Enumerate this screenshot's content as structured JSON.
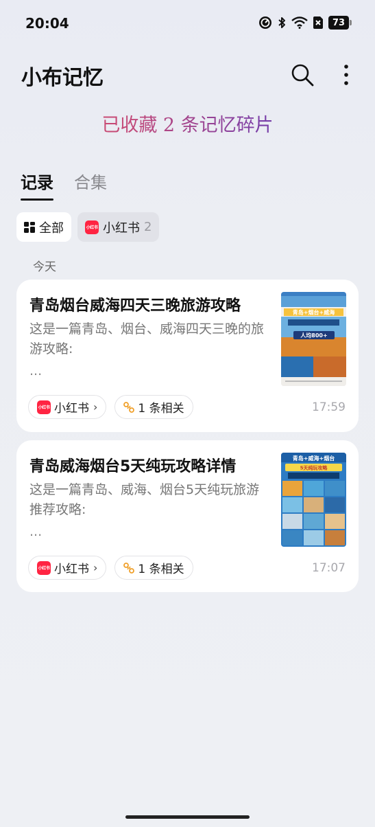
{
  "status_bar": {
    "time": "20:04",
    "battery": "73",
    "icons": [
      "speedometer-icon",
      "bluetooth-icon",
      "wifi-icon",
      "sim-blocked-icon",
      "battery-icon"
    ]
  },
  "app": {
    "title": "小布记忆",
    "search_icon": "search-icon",
    "more_icon": "more-vertical-icon"
  },
  "tagline": "已收藏 2 条记忆碎片",
  "tabs": [
    {
      "label": "记录",
      "active": true
    },
    {
      "label": "合集",
      "active": false
    }
  ],
  "filters": [
    {
      "label": "全部",
      "icon": "grid-icon",
      "selected": true
    },
    {
      "label": "小红书",
      "icon": "xiaohongshu-logo",
      "count": "2",
      "selected": false
    }
  ],
  "xhs_logo_text": "小红书",
  "section_date": "今天",
  "cards": [
    {
      "title": "青岛烟台威海四天三晚旅游攻略",
      "desc": "这是一篇青岛、烟台、威海四天三晚的旅游攻略:",
      "ellipsis": "...",
      "source": "小红书",
      "related": "1 条相关",
      "time": "17:59",
      "thumb_label": "青岛+烟台+威海",
      "thumb_sub": "人均800+"
    },
    {
      "title": "青岛威海烟台5天纯玩攻略详情",
      "desc": "这是一篇青岛、威海、烟台5天纯玩旅游推荐攻略:",
      "ellipsis": "...",
      "source": "小红书",
      "related": "1 条相关",
      "time": "17:07",
      "thumb_label": "青岛+威海+烟台",
      "thumb_sub": "5天纯玩攻略"
    }
  ],
  "colors": {
    "accent_red": "#ff2442",
    "gradient_start": "#e0485a",
    "gradient_end": "#5a3aa0",
    "related_icon": "#f0a02a"
  }
}
